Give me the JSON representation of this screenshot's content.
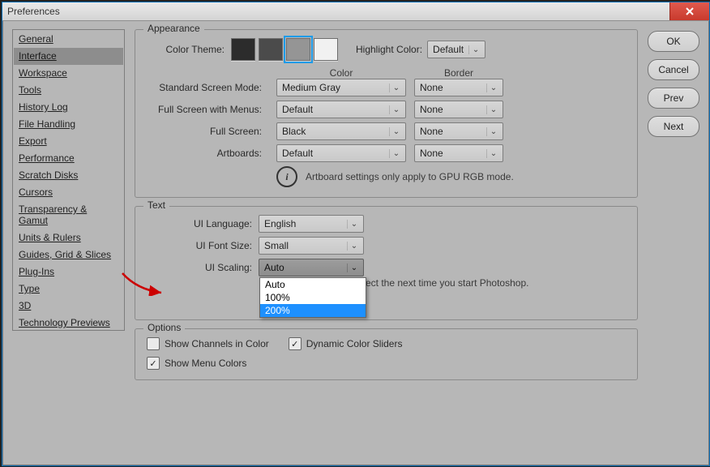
{
  "window": {
    "title": "Preferences"
  },
  "nav": {
    "items": [
      {
        "label": "General"
      },
      {
        "label": "Interface",
        "selected": true
      },
      {
        "label": "Workspace"
      },
      {
        "label": "Tools"
      },
      {
        "label": "History Log"
      },
      {
        "label": "File Handling"
      },
      {
        "label": "Export"
      },
      {
        "label": "Performance"
      },
      {
        "label": "Scratch Disks"
      },
      {
        "label": "Cursors"
      },
      {
        "label": "Transparency & Gamut"
      },
      {
        "label": "Units & Rulers"
      },
      {
        "label": "Guides, Grid & Slices"
      },
      {
        "label": "Plug-Ins"
      },
      {
        "label": "Type"
      },
      {
        "label": "3D"
      },
      {
        "label": "Technology Previews"
      }
    ]
  },
  "appearance": {
    "legend": "Appearance",
    "color_theme_label": "Color Theme:",
    "swatches": [
      {
        "color": "#2c2c2c"
      },
      {
        "color": "#4b4b4b"
      },
      {
        "color": "#959595",
        "selected": true
      },
      {
        "color": "#f1f1f1"
      }
    ],
    "highlight_label": "Highlight Color:",
    "highlight_value": "Default",
    "col_color": "Color",
    "col_border": "Border",
    "rows": [
      {
        "label": "Standard Screen Mode:",
        "color": "Medium Gray",
        "border": "None"
      },
      {
        "label": "Full Screen with Menus:",
        "color": "Default",
        "border": "None"
      },
      {
        "label": "Full Screen:",
        "color": "Black",
        "border": "None"
      },
      {
        "label": "Artboards:",
        "color": "Default",
        "border": "None"
      }
    ],
    "note": "Artboard settings only apply to GPU RGB mode."
  },
  "text": {
    "legend": "Text",
    "lang_label": "UI Language:",
    "lang_value": "English",
    "font_label": "UI Font Size:",
    "font_value": "Small",
    "scale_label": "UI Scaling:",
    "scale_value": "Auto",
    "scale_options": [
      "Auto",
      "100%",
      "200%"
    ],
    "scale_hover_index": 2,
    "note": "ect the next time you start Photoshop."
  },
  "options": {
    "legend": "Options",
    "items": [
      {
        "label": "Show Channels in Color",
        "checked": false
      },
      {
        "label": "Dynamic Color Sliders",
        "checked": true
      },
      {
        "label": "Show Menu Colors",
        "checked": true
      }
    ]
  },
  "actions": {
    "ok": "OK",
    "cancel": "Cancel",
    "prev": "Prev",
    "next": "Next"
  }
}
